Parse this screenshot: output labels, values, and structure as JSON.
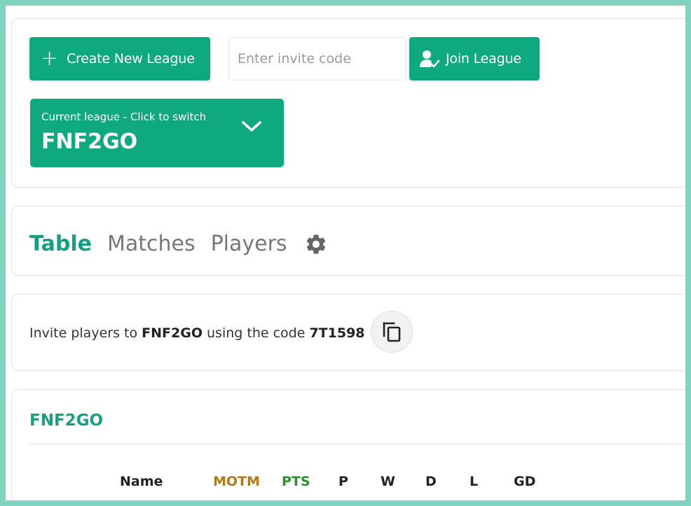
{
  "toolbar": {
    "create_label": "Create New League",
    "invite_placeholder": "Enter invite code",
    "join_label": "Join League"
  },
  "league_switcher": {
    "hint": "Current league - Click to switch",
    "current": "FNF2GO"
  },
  "tabs": [
    {
      "label": "Table",
      "active": true
    },
    {
      "label": "Matches",
      "active": false
    },
    {
      "label": "Players",
      "active": false
    }
  ],
  "invite": {
    "prefix": "Invite players to ",
    "league": "FNF2GO",
    "middle": " using the code ",
    "code": "7T1598"
  },
  "standings": {
    "title": "FNF2GO",
    "columns": [
      "Name",
      "MOTM",
      "PTS",
      "P",
      "W",
      "D",
      "L",
      "GD"
    ]
  },
  "colors": {
    "accent": "#0fa97f",
    "motm": "#b07a1c",
    "pts": "#2f8f2f",
    "frame": "#7fd3bf"
  }
}
